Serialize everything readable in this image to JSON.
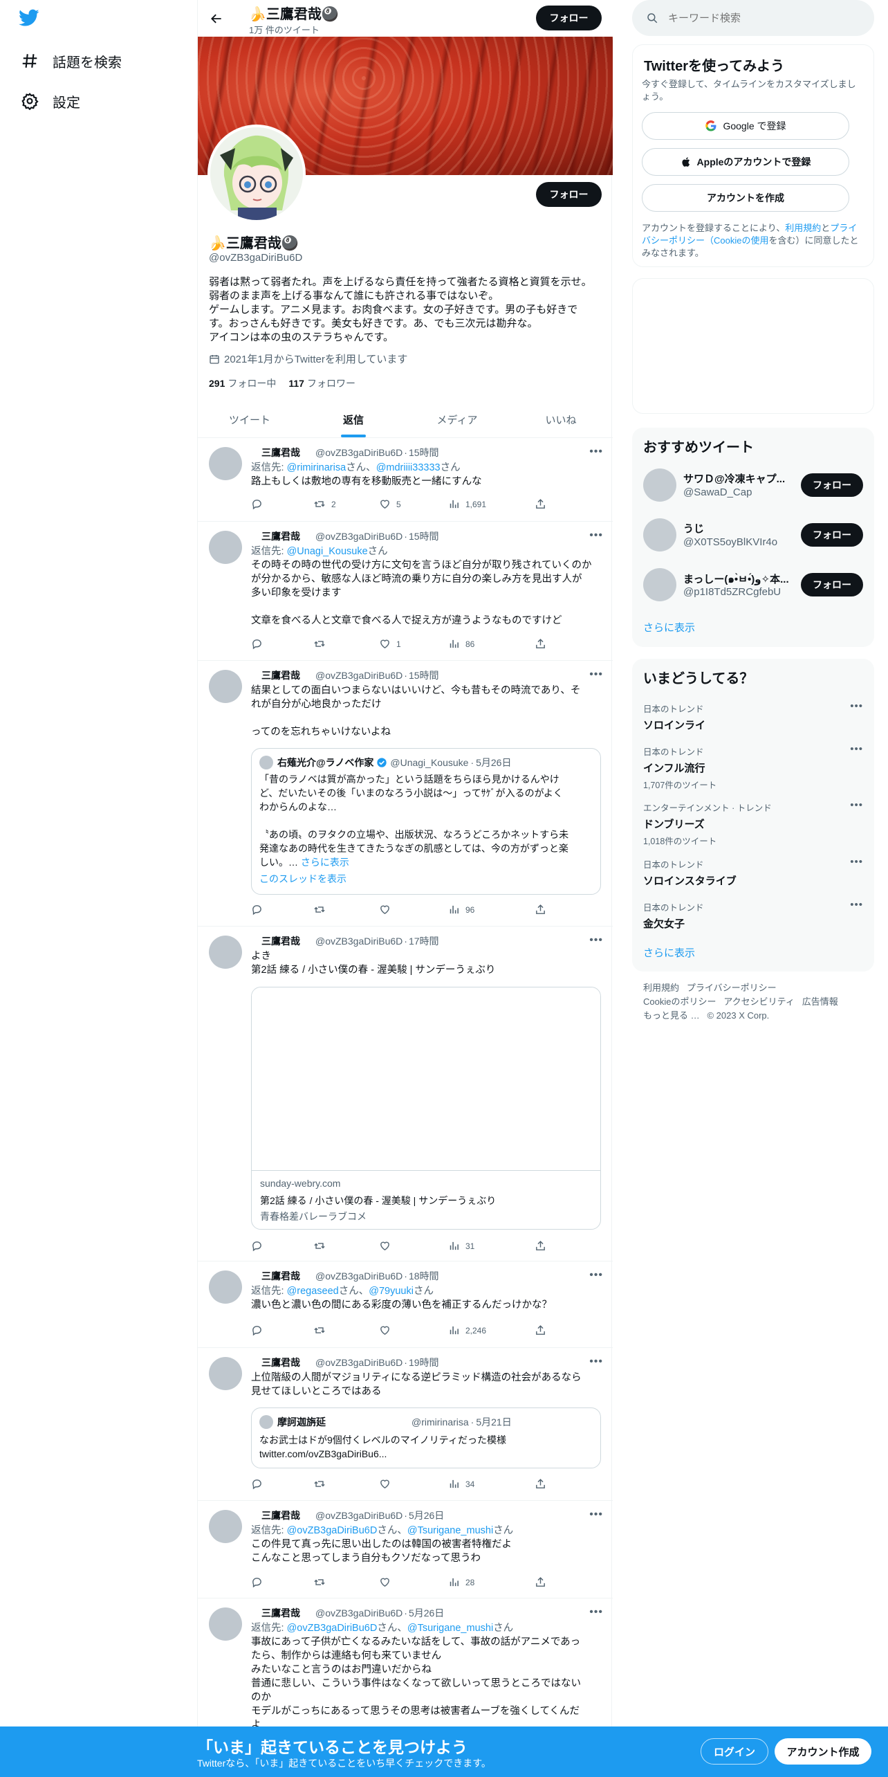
{
  "nav": {
    "explore_label": "話題を検索",
    "settings_label": "設定"
  },
  "header": {
    "name": "🍌三鷹君哉🎱",
    "tweet_count": "1万 件のツイート",
    "follow_label": "フォロー"
  },
  "profile": {
    "name": "🍌三鷹君哉🎱",
    "handle": "@ovZB3gaDiriBu6D",
    "follow_label": "フォロー",
    "bio_lines": [
      "弱者は黙って弱者たれ。声を上げるなら責任を持って強者たる資格と資質を示せ。",
      "弱者のまま声を上げる事なんて誰にも許される事ではないぞ。",
      "ゲームします。アニメ見ます。お肉食べます。女の子好きです。男の子も好きで",
      "す。おっさんも好きです。美女も好きです。あ、でも三次元は勘弁な。",
      "アイコンは本の虫のステラちゃんです。"
    ],
    "joined": "2021年1月からTwitterを利用しています",
    "following_count": "291",
    "following_label": "フォロー中",
    "followers_count": "117",
    "followers_label": "フォロワー"
  },
  "tabs": [
    "ツイート",
    "返信",
    "メディア",
    "いいね"
  ],
  "tweets": [
    {
      "name": "三鷹君哉",
      "handle": "@ovZB3gaDiriBu6D",
      "time": "15時間",
      "reply_prefix": "返信先: ",
      "reply_m1": "@rimirinarisa",
      "reply_mid": "さん、",
      "reply_m2": "@mdriiii33333",
      "reply_suffix": "さん",
      "lines": [
        "路上もしくは敷地の専有を移動販売と一緒にすんな"
      ],
      "retweets": "2",
      "likes": "5",
      "views": "1,691"
    },
    {
      "name": "三鷹君哉",
      "handle": "@ovZB3gaDiriBu6D",
      "time": "15時間",
      "reply_prefix": "返信先: ",
      "reply_m1": "@Unagi_Kousuke",
      "reply_suffix": "さん",
      "lines": [
        "その時その時の世代の受け方に文句を言うほど自分が取り残されていくのか",
        "が分かるから、敏感な人ほど時流の乗り方に自分の楽しみ方を見出す人が",
        "多い印象を受けます",
        "",
        "文章を食べる人と文章で食べる人で捉え方が違うようなものですけど"
      ],
      "retweets": "",
      "likes": "1",
      "views": "86"
    },
    {
      "name": "三鷹君哉",
      "handle": "@ovZB3gaDiriBu6D",
      "time": "15時間",
      "lines": [
        "結果としての面白いつまらないはいいけど、今も昔もその時流であり、そ",
        "れが自分が心地良かっただけ",
        "",
        "ってのを忘れちゃいけないよね"
      ],
      "quote": {
        "name": "右薙光介@ラノベ作家",
        "handle": "@Unagi_Kousuke",
        "date": "5月26日",
        "lines": [
          "「昔のラノベは質が高かった」という話題をちらほら見かけるんやけ",
          "ど、だいたいその後「いまのなろう小説は〜」ってｻｹﾞが入るのがよく",
          "わからんのよな…",
          "",
          "〝あの頃〟のヲタクの立場や、出版状況、なろうどころかネットすら未",
          "発達なあの時代を生きてきたうなぎの肌感としては、今の方がずっと楽",
          "しい。… "
        ],
        "show_more": "さらに表示",
        "show_thread": "このスレッドを表示"
      },
      "retweets": "",
      "likes": "",
      "views": "96"
    },
    {
      "name": "三鷹君哉",
      "handle": "@ovZB3gaDiriBu6D",
      "time": "17時間",
      "lines": [
        "よき",
        "第2話 練る / 小さい僕の春 - 渥美駿 | サンデーうぇぶり"
      ],
      "card": {
        "domain": "sunday-webry.com",
        "title": "第2話 練る / 小さい僕の春 - 渥美駿 | サンデーうぇぶり",
        "desc": "青春格差バレーラブコメ"
      },
      "retweets": "",
      "likes": "",
      "views": "31"
    },
    {
      "name": "三鷹君哉",
      "handle": "@ovZB3gaDiriBu6D",
      "time": "18時間",
      "reply_prefix": "返信先: ",
      "reply_m1": "@regaseed",
      "reply_mid": "さん、",
      "reply_m2": "@79yuuki",
      "reply_suffix": "さん",
      "lines": [
        "濃い色と濃い色の間にある彩度の薄い色を補正するんだっけかな？"
      ],
      "retweets": "",
      "likes": "",
      "views": "2,246"
    },
    {
      "name": "三鷹君哉",
      "handle": "@ovZB3gaDiriBu6D",
      "time": "19時間",
      "lines": [
        "上位階級の人間がマジョリティになる逆ピラミッド構造の社会があるなら",
        "見せてほしいところではある"
      ],
      "quote": {
        "name": "摩訶迦旃延",
        "handle": "@rimirinarisa",
        "date": "5月21日",
        "lines": [
          "なお武士はドが9個付くレベルのマイノリティだった模様",
          "twitter.com/ovZB3gaDiriBu6..."
        ]
      },
      "retweets": "",
      "likes": "",
      "views": "34"
    },
    {
      "name": "三鷹君哉",
      "handle": "@ovZB3gaDiriBu6D",
      "time": "5月26日",
      "reply_prefix": "返信先: ",
      "reply_m1": "@ovZB3gaDiriBu6D",
      "reply_mid": "さん、",
      "reply_m2": "@Tsurigane_mushi",
      "reply_suffix": "さん",
      "lines": [
        "この件見て真っ先に思い出したのは韓国の被害者特権だよ",
        "こんなこと思ってしまう自分もクソだなって思うわ"
      ],
      "retweets": "",
      "likes": "",
      "views": "28"
    },
    {
      "name": "三鷹君哉",
      "handle": "@ovZB3gaDiriBu6D",
      "time": "5月26日",
      "reply_prefix": "返信先: ",
      "reply_m1": "@ovZB3gaDiriBu6D",
      "reply_mid": "さん、",
      "reply_m2": "@Tsurigane_mushi",
      "reply_suffix": "さん",
      "lines": [
        "事故にあって子供が亡くなるみたいな話をして、事故の話がアニメであっ",
        "たら、制作からは連絡も何も来ていません",
        "みたいなこと言うのはお門違いだからね",
        "普通に悲しい、こういう事件はなくなって欲しいって思うところではない",
        "のか",
        "モデルがこっちにあるって思うその思考は被害者ムーブを強くしてくんだ",
        "よ"
      ]
    }
  ],
  "right": {
    "search_placeholder": "キーワード検索",
    "signup_title": "Twitterを使ってみよう",
    "signup_sub": "今すぐ登録して、タイムラインをカスタマイズしましょう。",
    "google_btn": "Google で登録",
    "apple_btn": "Appleのアカウントで登録",
    "create_btn": "アカウントを作成",
    "terms_1": "アカウントを登録することにより、",
    "terms_link1": "利用規約",
    "terms_2": "と",
    "terms_link2": "プライバシーポリシー（Cookieの使用",
    "terms_3": "を含む）に同意したとみなされます。",
    "wtf_title": "おすすめツイート",
    "wtf": [
      {
        "name": "サワＤ@冷凍キャプ...",
        "handle": "@SawaD_Cap",
        "button": "フォロー"
      },
      {
        "name": "うじ",
        "handle": "@X0TS5oyBlKVIr4o",
        "button": "フォロー"
      },
      {
        "name": "まっしー(๑•̀ㅂ•́)و✧本...",
        "handle": "@p1I8Td5ZRCgfebU",
        "button": "フォロー"
      }
    ],
    "wtf_more": "さらに表示",
    "trends_title": "いまどうしてる？",
    "trends": [
      {
        "context": "日本のトレンド",
        "title": "ソロインライ",
        "count": ""
      },
      {
        "context": "日本のトレンド",
        "title": "インフル流行",
        "count": "1,707件のツイート"
      },
      {
        "context": "エンターテインメント · トレンド",
        "title": "ドンブリーズ",
        "count": "1,018件のツイート"
      },
      {
        "context": "日本のトレンド",
        "title": "ソロインスタライブ",
        "count": ""
      },
      {
        "context": "日本のトレンド",
        "title": "金欠女子",
        "count": ""
      }
    ],
    "trends_more": "さらに表示",
    "footer": {
      "l1a": "利用規約",
      "l1b": "プライバシーポリシー",
      "l2a": "Cookieのポリシー",
      "l2b": "アクセシビリティ",
      "l2c": "広告情報",
      "l3a": "もっと見る …",
      "l3b": "© 2023 X Corp."
    }
  },
  "bottombar": {
    "title": "「いま」起きていることを見つけよう",
    "sub": "Twitterなら、「いま」起きていることをいち早くチェックできます。",
    "login": "ログイン",
    "signup": "アカウント作成"
  },
  "colors": {
    "accent": "#1d9bf0",
    "text": "#0f1419",
    "muted": "#536471"
  }
}
